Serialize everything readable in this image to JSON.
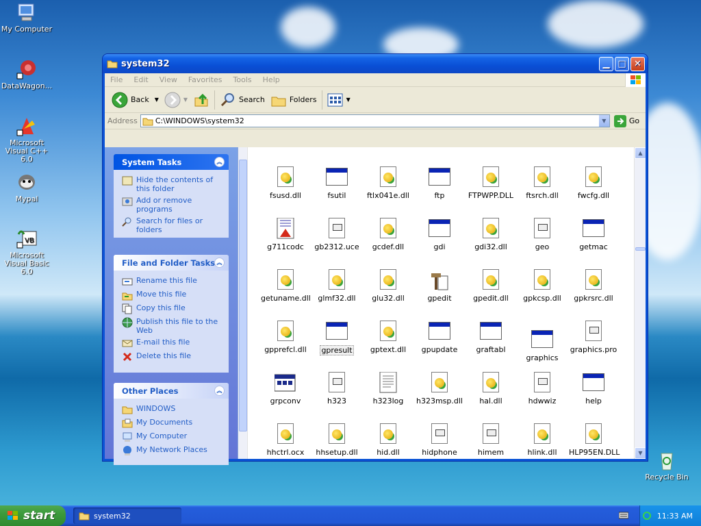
{
  "desktop": {
    "icons": [
      {
        "label": "My Computer"
      },
      {
        "label": "DataWagon..."
      },
      {
        "label": "Microsoft Visual C++ 6.0"
      },
      {
        "label": "Mypal"
      },
      {
        "label": "Microsoft Visual Basic 6.0"
      },
      {
        "label": "Recycle Bin"
      }
    ]
  },
  "window": {
    "title": "system32",
    "menu": [
      "File",
      "Edit",
      "View",
      "Favorites",
      "Tools",
      "Help"
    ],
    "toolbar": {
      "back": "Back",
      "search": "Search",
      "folders": "Folders"
    },
    "address": {
      "label": "Address",
      "value": "C:\\WINDOWS\\system32",
      "go": "Go"
    }
  },
  "left_pane": {
    "system_tasks": {
      "title": "System Tasks",
      "items": [
        "Hide the contents of this folder",
        "Add or remove programs",
        "Search for files or folders"
      ]
    },
    "file_tasks": {
      "title": "File and Folder Tasks",
      "items": [
        "Rename this file",
        "Move this file",
        "Copy this file",
        "Publish this file to the Web",
        "E-mail this file",
        "Delete this file"
      ]
    },
    "other_places": {
      "title": "Other Places",
      "items": [
        "WINDOWS",
        "My Documents",
        "My Computer",
        "My Network Places"
      ]
    }
  },
  "files": [
    [
      "fsusd.dll",
      "fsutil",
      "ftlx041e.dll",
      "ftp",
      "FTPWPP.DLL",
      "ftsrch.dll",
      "fwcfg.dll"
    ],
    [
      "g711codc",
      "gb2312.uce",
      "gcdef.dll",
      "gdi",
      "gdi32.dll",
      "geo",
      "getmac"
    ],
    [
      "getuname.dll",
      "glmf32.dll",
      "glu32.dll",
      "gpedit",
      "gpedit.dll",
      "gpkcsp.dll",
      "gpkrsrc.dll"
    ],
    [
      "gpprefcl.dll",
      "gpresult",
      "gptext.dll",
      "gpupdate",
      "graftabl",
      "graphics",
      "graphics.pro"
    ],
    [
      "grpconv",
      "h323",
      "h323log",
      "h323msp.dll",
      "hal.dll",
      "hdwwiz",
      "help"
    ],
    [
      "hhctrl.ocx",
      "hhsetup.dll",
      "hid.dll",
      "hidphone",
      "himem",
      "hlink.dll",
      "HLP95EN.DLL"
    ]
  ],
  "file_types": [
    [
      "dll",
      "exe",
      "dll",
      "exe",
      "dll",
      "dll",
      "dll"
    ],
    [
      "media",
      "doc",
      "dll",
      "exe",
      "dll",
      "doc",
      "exe"
    ],
    [
      "dll",
      "dll",
      "dll",
      "tool",
      "dll",
      "dll",
      "dll"
    ],
    [
      "dll",
      "exe",
      "dll",
      "exe",
      "exe",
      "exe",
      "doc"
    ],
    [
      "grp",
      "doc",
      "text",
      "dll",
      "dll",
      "doc",
      "exe"
    ],
    [
      "dll",
      "dll",
      "dll",
      "doc",
      "doc",
      "dll",
      "dll"
    ]
  ],
  "taskbar": {
    "start": "start",
    "task": "system32",
    "clock": "11:33 AM"
  },
  "colors": {
    "accent": "#0a53d6",
    "link": "#215dc6",
    "taskbar": "#245edb",
    "start": "#3c9a3c"
  }
}
